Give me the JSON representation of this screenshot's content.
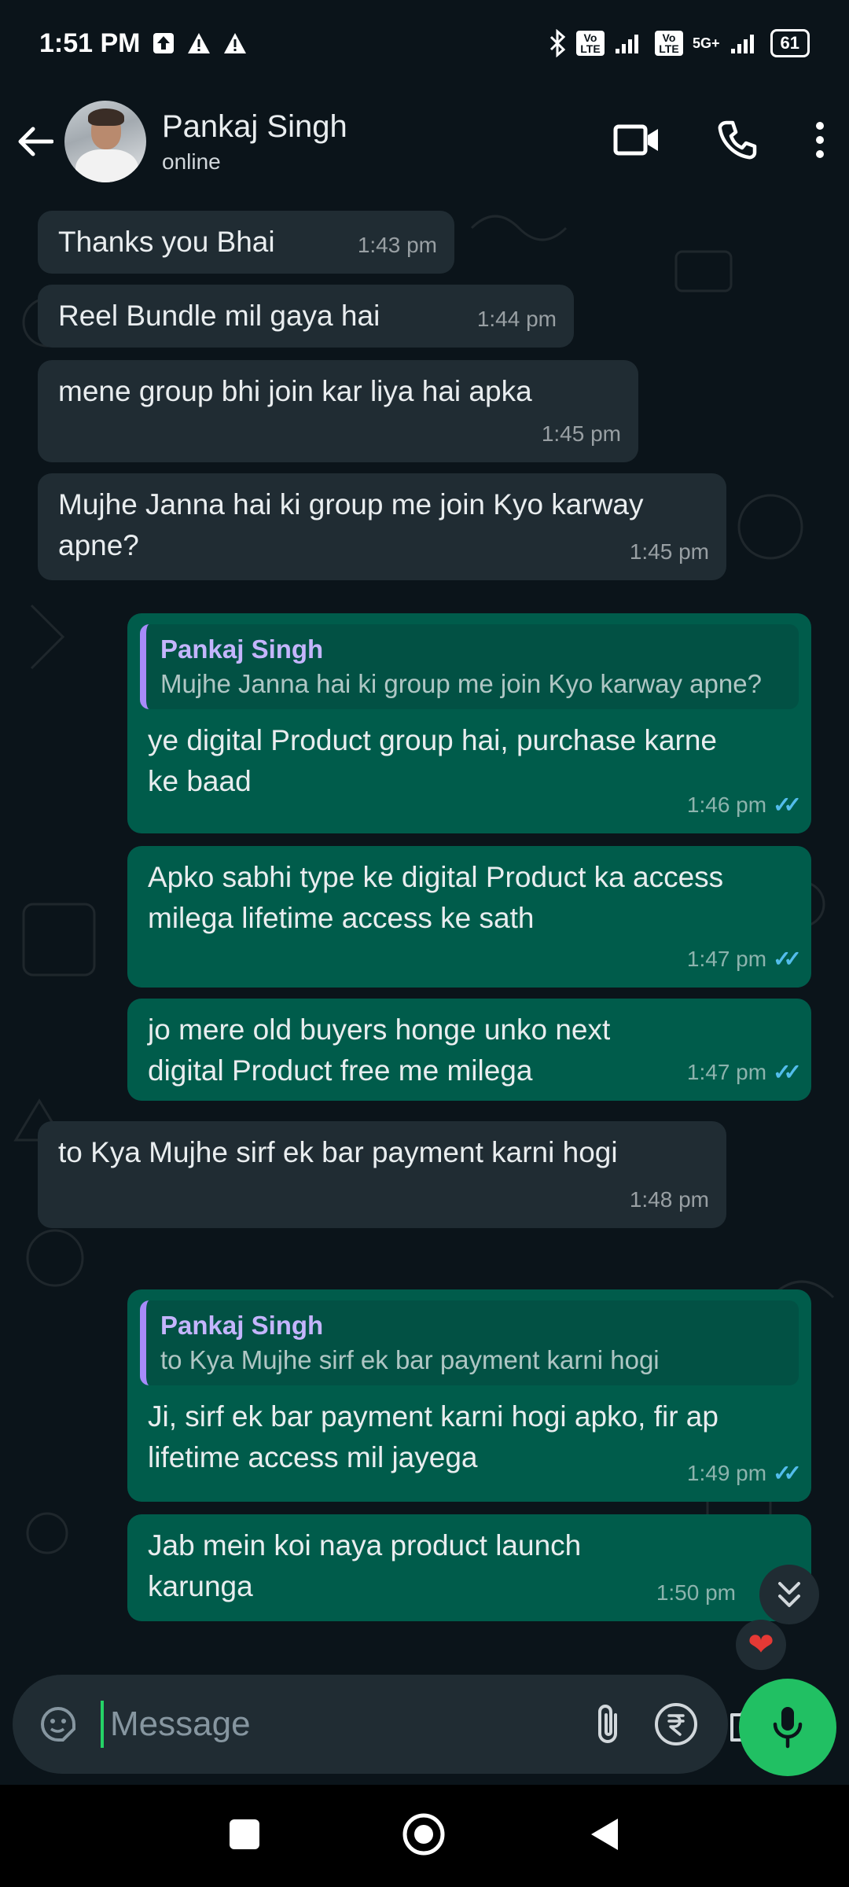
{
  "status_bar": {
    "time": "1:51 PM",
    "battery": "61",
    "network": "5G+",
    "volte1": "Vo LTE",
    "volte2": "Vo LTE"
  },
  "header": {
    "contact_name": "Pankaj Singh",
    "status": "online"
  },
  "messages": [
    {
      "dir": "in",
      "text": "Thanks you Bhai",
      "time": "1:43 pm"
    },
    {
      "dir": "in",
      "text": "Reel Bundle mil gaya hai",
      "time": "1:44 pm"
    },
    {
      "dir": "in",
      "text": "mene group bhi join kar liya hai apka",
      "time": "1:45 pm"
    },
    {
      "dir": "in",
      "text": "Mujhe Janna hai ki group me join Kyo karway apne?",
      "time": "1:45 pm"
    },
    {
      "dir": "out",
      "quote_name": "Pankaj Singh",
      "quote_text": "Mujhe Janna hai ki group me join Kyo karway apne?",
      "text": "ye digital Product group hai, purchase karne ke baad",
      "time": "1:46 pm"
    },
    {
      "dir": "out",
      "text": "Apko sabhi type ke digital Product ka access milega lifetime access ke sath",
      "time": "1:47 pm"
    },
    {
      "dir": "out",
      "text": "jo mere old buyers honge unko next digital Product free me milega",
      "time": "1:47 pm"
    },
    {
      "dir": "in",
      "text": "to Kya Mujhe sirf ek bar payment karni hogi",
      "time": "1:48 pm"
    },
    {
      "dir": "out",
      "quote_name": "Pankaj Singh",
      "quote_text": "to Kya Mujhe sirf ek bar payment karni hogi",
      "text": "Ji, sirf ek bar payment karni hogi apko, fir ap lifetime access mil jayega",
      "time": "1:49 pm"
    },
    {
      "dir": "out",
      "text": "Jab mein koi naya product launch karunga",
      "time": "1:50 pm"
    }
  ],
  "composer": {
    "placeholder": "Message"
  },
  "reaction": "heart",
  "colors": {
    "incoming_bubble": "#202c33",
    "outgoing_bubble": "#005c4b",
    "background": "#0b141a",
    "accent_green": "#21c063",
    "read_ticks": "#53bdeb",
    "quote_bar": "#a78bfa"
  },
  "icons": [
    "back-arrow-icon",
    "video-call-icon",
    "phone-icon",
    "more-vert-icon",
    "sticker-icon",
    "attach-icon",
    "rupee-icon",
    "camera-icon",
    "mic-icon",
    "chevrons-down-icon",
    "heart-icon",
    "nav-square-icon",
    "nav-home-icon",
    "nav-back-icon"
  ]
}
